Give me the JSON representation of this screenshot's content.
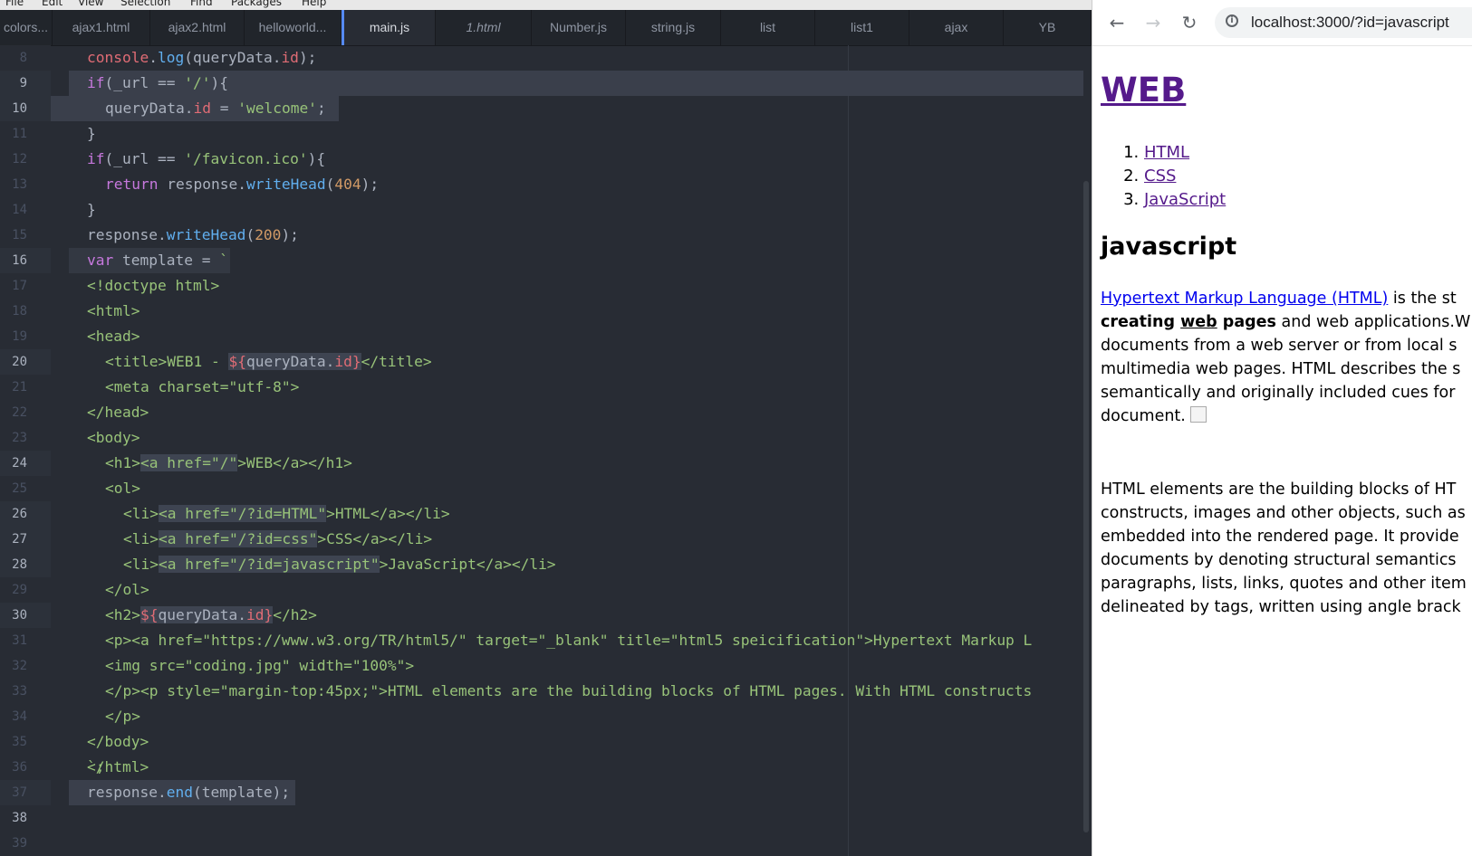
{
  "editor": {
    "menu": [
      "File",
      "Edit",
      "View",
      "Selection",
      "Find",
      "Packages",
      "Help"
    ],
    "tabs": [
      {
        "label": "colors..."
      },
      {
        "label": "ajax1.html"
      },
      {
        "label": "ajax2.html"
      },
      {
        "label": "helloworld..."
      },
      {
        "label": "main.js"
      },
      {
        "label": "1.html"
      },
      {
        "label": "Number.js"
      },
      {
        "label": "string.js"
      },
      {
        "label": "list"
      },
      {
        "label": "list1"
      },
      {
        "label": "ajax"
      },
      {
        "label": "YB"
      }
    ],
    "line_numbers": [
      "8",
      "9",
      "10",
      "11",
      "12",
      "13",
      "14",
      "15",
      "16",
      "17",
      "18",
      "19",
      "20",
      "21",
      "22",
      "23",
      "24",
      "25",
      "26",
      "27",
      "28",
      "29",
      "30",
      "31",
      "32",
      "33",
      "34",
      "35",
      "36",
      "37",
      "38",
      "39"
    ],
    "code": {
      "l8": {
        "a": "console",
        "b": ".",
        "c": "log",
        "d": "(queryData.",
        "e": "id",
        "f": ");"
      },
      "l9": {
        "a": "if",
        "b": "(_url == ",
        "c": "'/'",
        "d": "){"
      },
      "l10": {
        "a": "queryData.",
        "b": "id",
        "c": " = ",
        "d": "'welcome'",
        "e": ";"
      },
      "l11": "}",
      "l12": {
        "a": "if",
        "b": "(_url == ",
        "c": "'/favicon.ico'",
        "d": "){"
      },
      "l13": {
        "a": "return",
        "b": " response.",
        "c": "writeHead",
        "d": "(",
        "e": "404",
        "f": ");"
      },
      "l14": "}",
      "l15": {
        "a": "response.",
        "b": "writeHead",
        "c": "(",
        "d": "200",
        "e": ");"
      },
      "l16": {
        "a": "var",
        "b": " template = ",
        "c": "`"
      },
      "l17": "<!doctype html>",
      "l18": "<html>",
      "l19": "<head>",
      "l20": {
        "a": "<title>WEB1 - ",
        "b": "${",
        "c": "queryData.",
        "d": "id",
        "e": "}",
        "f": "</title>"
      },
      "l21": "<meta charset=\"utf-8\">",
      "l22": "</head>",
      "l23": "<body>",
      "l24": {
        "a": "<h1>",
        "b": "<a href=\"/\"",
        "c": ">WEB</a></h1>"
      },
      "l25": "<ol>",
      "l26": {
        "a": "<li>",
        "b": "<a href=\"/?id=HTML\"",
        "c": ">HTML</a></li>"
      },
      "l27": {
        "a": "<li>",
        "b": "<a href=\"/?id=css\"",
        "c": ">CSS</a></li>"
      },
      "l28": {
        "a": "<li>",
        "b": "<a href=\"/?id=javascript\"",
        "c": ">JavaScript</a></li>"
      },
      "l29": "</ol>",
      "l30": {
        "a": "<h2>",
        "b": "${",
        "c": "queryData.",
        "d": "id",
        "e": "}",
        "f": "</h2>"
      },
      "l31": "<p><a href=\"https://www.w3.org/TR/html5/\" target=\"_blank\" title=\"html5 speicification\">Hypertext Markup L",
      "l32": "<img src=\"coding.jpg\" width=\"100%\">",
      "l33": "</p><p style=\"margin-top:45px;\">HTML elements are the building blocks of HTML pages. With HTML constructs",
      "l34": "</p>",
      "l35": "</body>",
      "l36": "</html>",
      "l37": "`;",
      "l38": {
        "a": "response.",
        "b": "end",
        "c": "(template);"
      },
      "l39": ""
    }
  },
  "browser": {
    "url": "localhost:3000/?id=javascript",
    "page": {
      "h1": "WEB",
      "list": [
        "HTML",
        "CSS",
        "JavaScript"
      ],
      "h2": "javascript",
      "p1": {
        "link": "Hypertext Markup Language (HTML)",
        "t1": " is the st",
        "b1": "creating ",
        "b2": "web",
        "b3": " pages",
        "t2": " and web applications.W",
        "l3": "documents from a web server or from local s",
        "l4": "multimedia web pages. HTML describes the s",
        "l5": "semantically and originally included cues for",
        "l6": "document. "
      },
      "p2": [
        "HTML elements are the building blocks of HT",
        "constructs, images and other objects, such as",
        "embedded into the rendered page. It provide",
        "documents by denoting structural semantics",
        "paragraphs, lists, links, quotes and other item",
        "delineated by tags, written using angle brack"
      ]
    }
  }
}
